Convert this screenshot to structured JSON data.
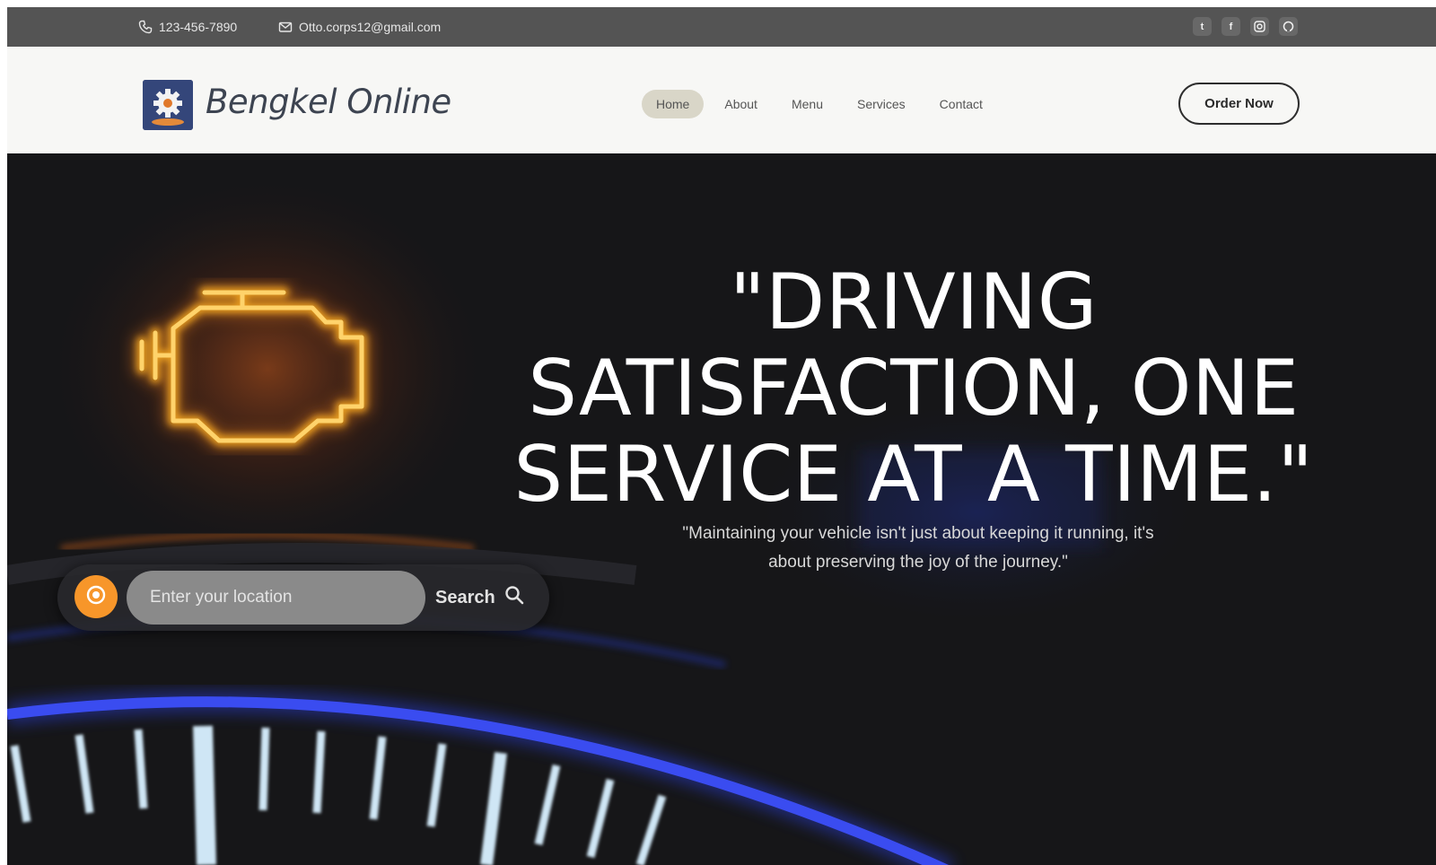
{
  "topbar": {
    "phone": "123-456-7890",
    "email": "Otto.corps12@gmail.com",
    "socials": [
      {
        "icon": "twitter-icon",
        "glyph": "t"
      },
      {
        "icon": "facebook-icon",
        "glyph": "f"
      },
      {
        "icon": "instagram-icon",
        "glyph": ""
      },
      {
        "icon": "github-icon",
        "glyph": ""
      }
    ]
  },
  "nav": {
    "brand": "Bengkel Online",
    "items": [
      {
        "label": "Home",
        "active": true
      },
      {
        "label": "About",
        "active": false
      },
      {
        "label": "Menu",
        "active": false
      },
      {
        "label": "Services",
        "active": false
      },
      {
        "label": "Contact",
        "active": false
      }
    ],
    "cta": "Order Now"
  },
  "hero": {
    "headline_line1": "\"DRIVING",
    "headline_line2": "SATISFACTION, ONE",
    "headline_line3": "SERVICE AT A TIME.\"",
    "subtext_line1": "\"Maintaining your vehicle isn't just about keeping it running, it's",
    "subtext_line2": "about preserving the joy of the journey.\"",
    "search": {
      "placeholder": "Enter your location",
      "button_label": "Search"
    }
  },
  "colors": {
    "topbar_bg": "#545454",
    "accent_orange": "#f7962a",
    "hero_bg": "#161618",
    "brand_blue": "#34467a"
  }
}
